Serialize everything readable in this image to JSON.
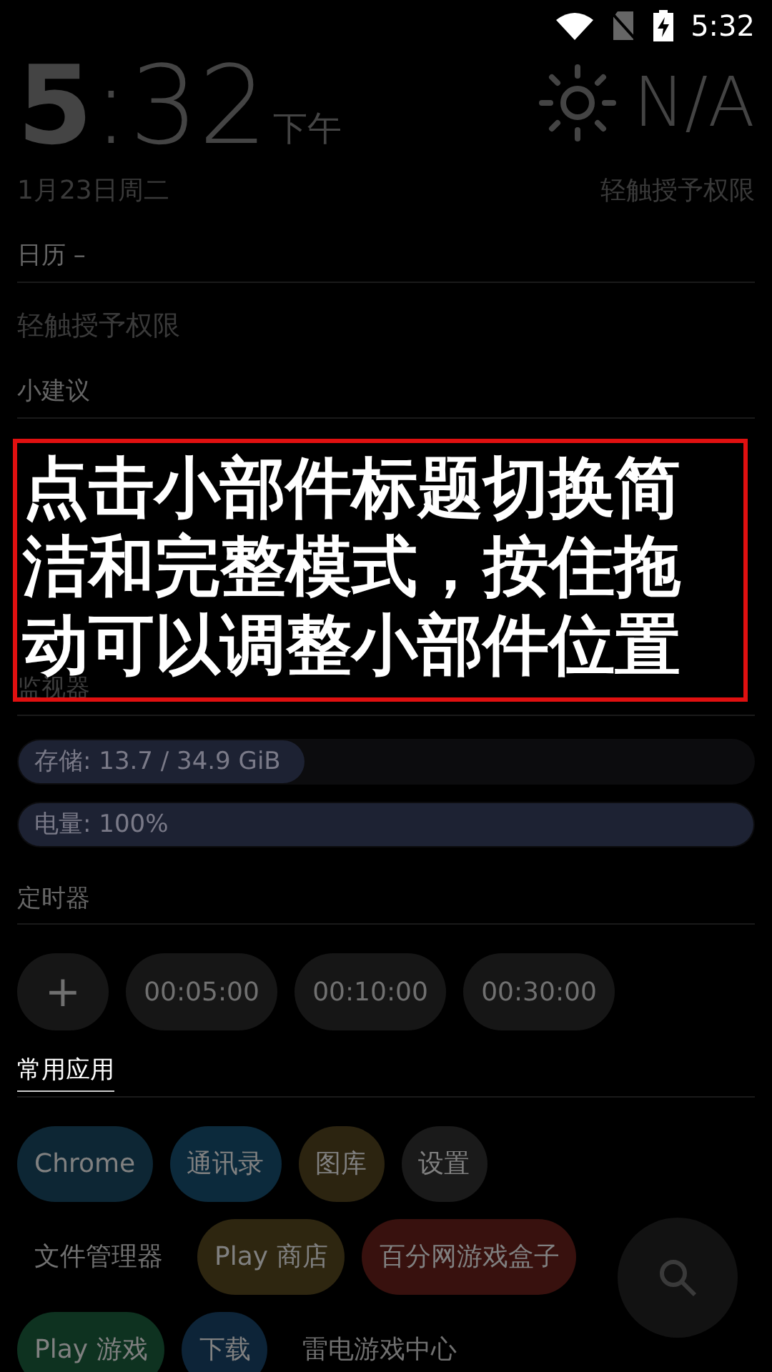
{
  "status_bar": {
    "time": "5:32"
  },
  "clock": {
    "hour": "5",
    "minutes": ":32",
    "period": "下午",
    "date": "1月23日周二"
  },
  "weather": {
    "temperature": "N/A",
    "hint": "轻触授予权限"
  },
  "calendar": {
    "title": "日历 –",
    "message": "轻触授予权限"
  },
  "tips": {
    "title": "小建议"
  },
  "tutorial": {
    "text": "点击小部件标题切换简洁和完整模式，按住拖动可以调整小部件位置"
  },
  "monitor": {
    "title": "监视器",
    "meters": [
      {
        "label": "存储: 13.7 / 34.9 GiB",
        "level": 0.39
      },
      {
        "label": "电量: 100%",
        "level": 1
      }
    ]
  },
  "timer": {
    "title": "定时器",
    "add": "+",
    "presets": [
      "00:05:00",
      "00:10:00",
      "00:30:00"
    ]
  },
  "apps": {
    "title": "常用应用",
    "highlighted": true,
    "rows": [
      [
        {
          "label": "Chrome",
          "kind": "chip",
          "color": "#0d2634"
        },
        {
          "label": "通讯录",
          "kind": "chip",
          "color": "#0c2a3c"
        },
        {
          "label": "图库",
          "kind": "chip",
          "color": "#2c2410"
        },
        {
          "label": "设置",
          "kind": "chip",
          "color": "#1a1a1a"
        }
      ],
      [
        {
          "label": "文件管理器",
          "kind": "plain"
        },
        {
          "label": "Play 商店",
          "kind": "chip",
          "color": "#2e2610"
        },
        {
          "label": "百分网游戏盒子",
          "kind": "chip",
          "color": "#38110e"
        }
      ],
      [
        {
          "label": "Play 游戏",
          "kind": "chip",
          "color": "#0e3220"
        },
        {
          "label": "下载",
          "kind": "chip",
          "color": "#0d2438"
        },
        {
          "label": "雷电游戏中心",
          "kind": "plain"
        }
      ]
    ]
  }
}
